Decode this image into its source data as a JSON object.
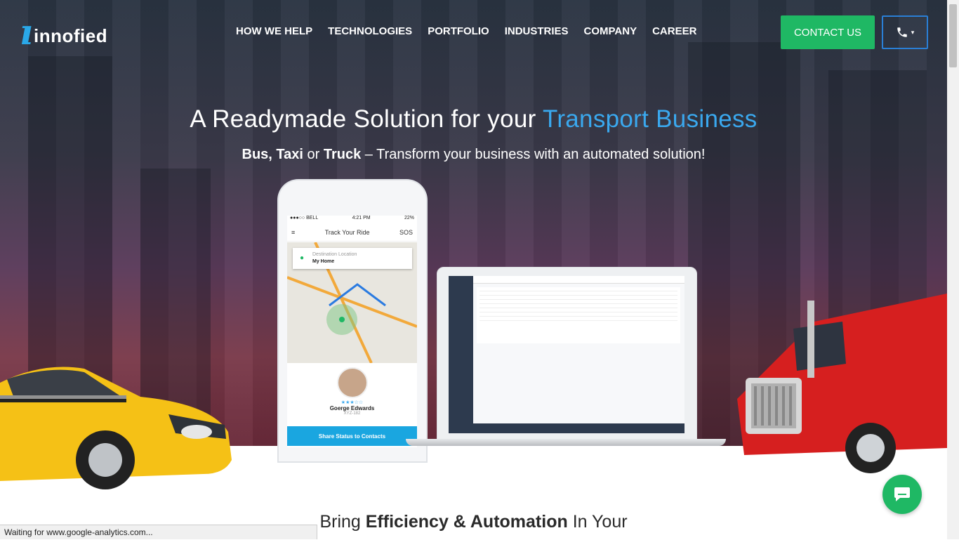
{
  "brand": {
    "logo_text": "innofied"
  },
  "nav": {
    "items": [
      "HOW WE HELP",
      "TECHNOLOGIES",
      "PORTFOLIO",
      "INDUSTRIES",
      "COMPANY",
      "CAREER"
    ]
  },
  "header": {
    "contact_label": "CONTACT US",
    "phone_icon": "phone-icon",
    "caret": "▾"
  },
  "hero": {
    "title_prefix": "A Readymade Solution for your ",
    "title_highlight": "Transport Business",
    "sub_bus": "Bus,",
    "sub_taxi": "Taxi",
    "sub_or": " or ",
    "sub_truck": "Truck",
    "sub_rest": " – Transform your business with an automated solution!"
  },
  "phone_app": {
    "carrier": "●●●○○ BELL",
    "time": "4:21 PM",
    "battery": "22%",
    "title": "Track Your Ride",
    "sos": "SOS",
    "dest_label": "Destination Location",
    "dest_value": "My Home",
    "driver_name": "Goerge Edwards",
    "driver_code": "XYZ-182",
    "stars": "★★★☆☆",
    "share_button": "Share Status to Contacts"
  },
  "section": {
    "heading_a": "Bring ",
    "heading_b": "Efficiency & Automation",
    "heading_c": " In Your"
  },
  "browser_status": "Waiting for www.google-analytics.com...",
  "colors": {
    "accent_blue": "#3aa8ee",
    "cta_green": "#1fb864"
  }
}
